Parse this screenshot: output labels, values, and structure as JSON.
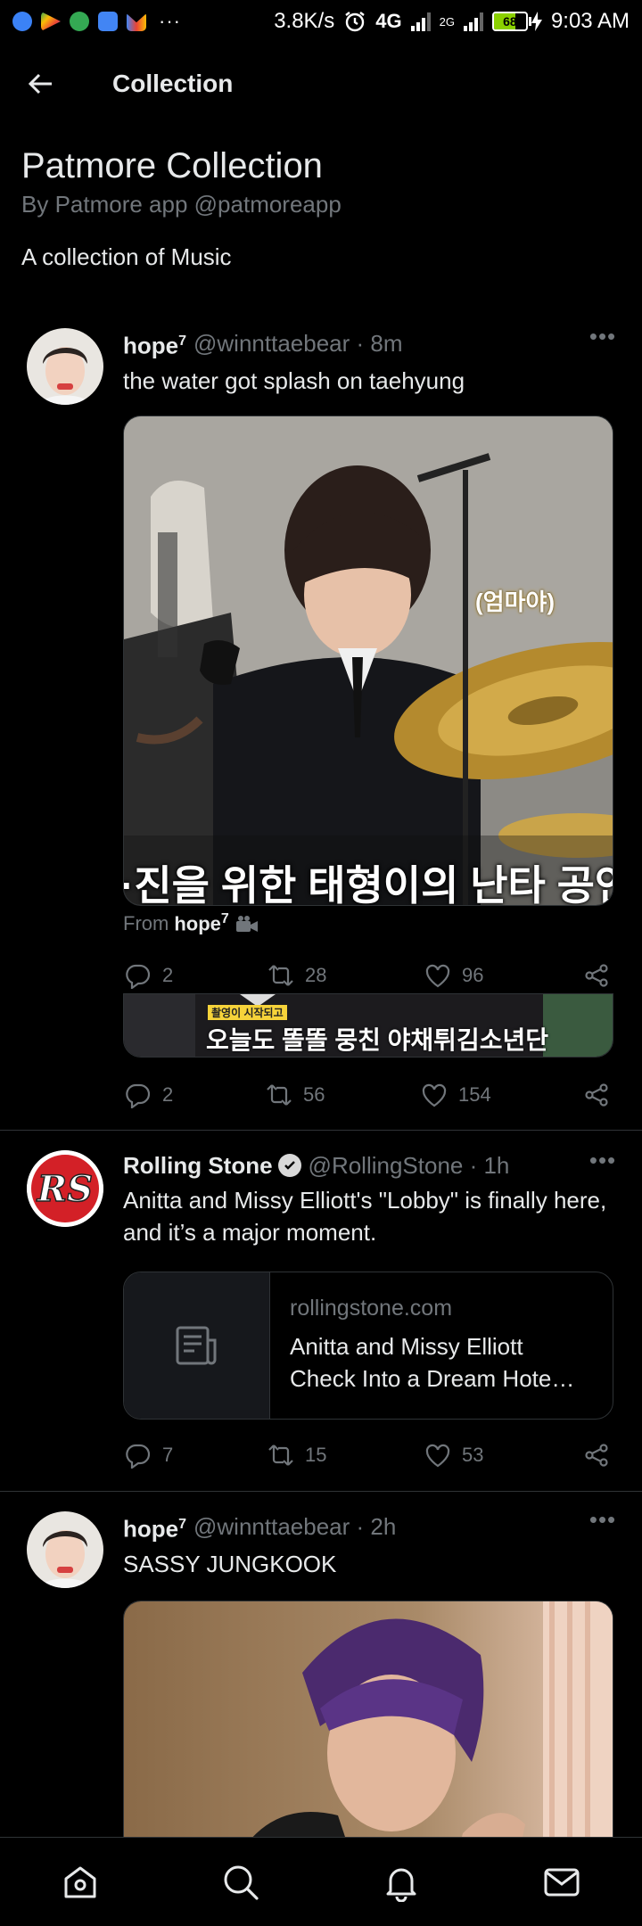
{
  "status_bar": {
    "net_speed": "3.8K/s",
    "net_4g": "4G",
    "net_2g": "2G",
    "battery": "68",
    "time": "9:03 AM"
  },
  "header": {
    "title": "Collection"
  },
  "collection": {
    "title": "Patmore Collection",
    "by": "By Patmore app @patmoreapp",
    "description": "A collection of Music"
  },
  "tweets": [
    {
      "name": "hope",
      "name_sup": "7",
      "handle": "@winnttaebear · 8m",
      "text": "the water got splash on taehyung",
      "media_caption": "(엄마야)",
      "media_subtitle": "·진을 위한 태형이의 난타 공연",
      "from_label": "From",
      "from_name": "hope",
      "from_sup": "7",
      "quote_stats": {
        "replies": "2",
        "retweets": "28",
        "likes": "96"
      },
      "quote_banner_small": "촬영이 시작되고",
      "quote_banner": "오늘도 똘똘 뭉친 야채튀김소년단",
      "stats": {
        "replies": "2",
        "retweets": "56",
        "likes": "154"
      }
    },
    {
      "name": "Rolling Stone",
      "handle": "@RollingStone · 1h",
      "text": "Anitta and Missy Elliott's \"Lobby\" is finally here, and it’s a major moment.",
      "avatar_text": "RS",
      "card": {
        "domain": "rollingstone.com",
        "title": "Anitta and Missy Elliott Check Into a Dream Hote…"
      },
      "stats": {
        "replies": "7",
        "retweets": "15",
        "likes": "53"
      }
    },
    {
      "name": "hope",
      "name_sup": "7",
      "handle": "@winnttaebear · 2h",
      "text": "SASSY JUNGKOOK"
    }
  ],
  "icons": {
    "back": "arrow-left-icon",
    "more": "more-icon",
    "reply": "reply-icon",
    "retweet": "retweet-icon",
    "like": "heart-icon",
    "share": "share-icon",
    "home": "home-icon",
    "search": "search-icon",
    "notifications": "bell-icon",
    "messages": "mail-icon"
  },
  "colors": {
    "background": "#000000",
    "text": "#e7e9ea",
    "muted": "#71767b",
    "border": "#2f3336",
    "rs_red": "#d32027"
  }
}
